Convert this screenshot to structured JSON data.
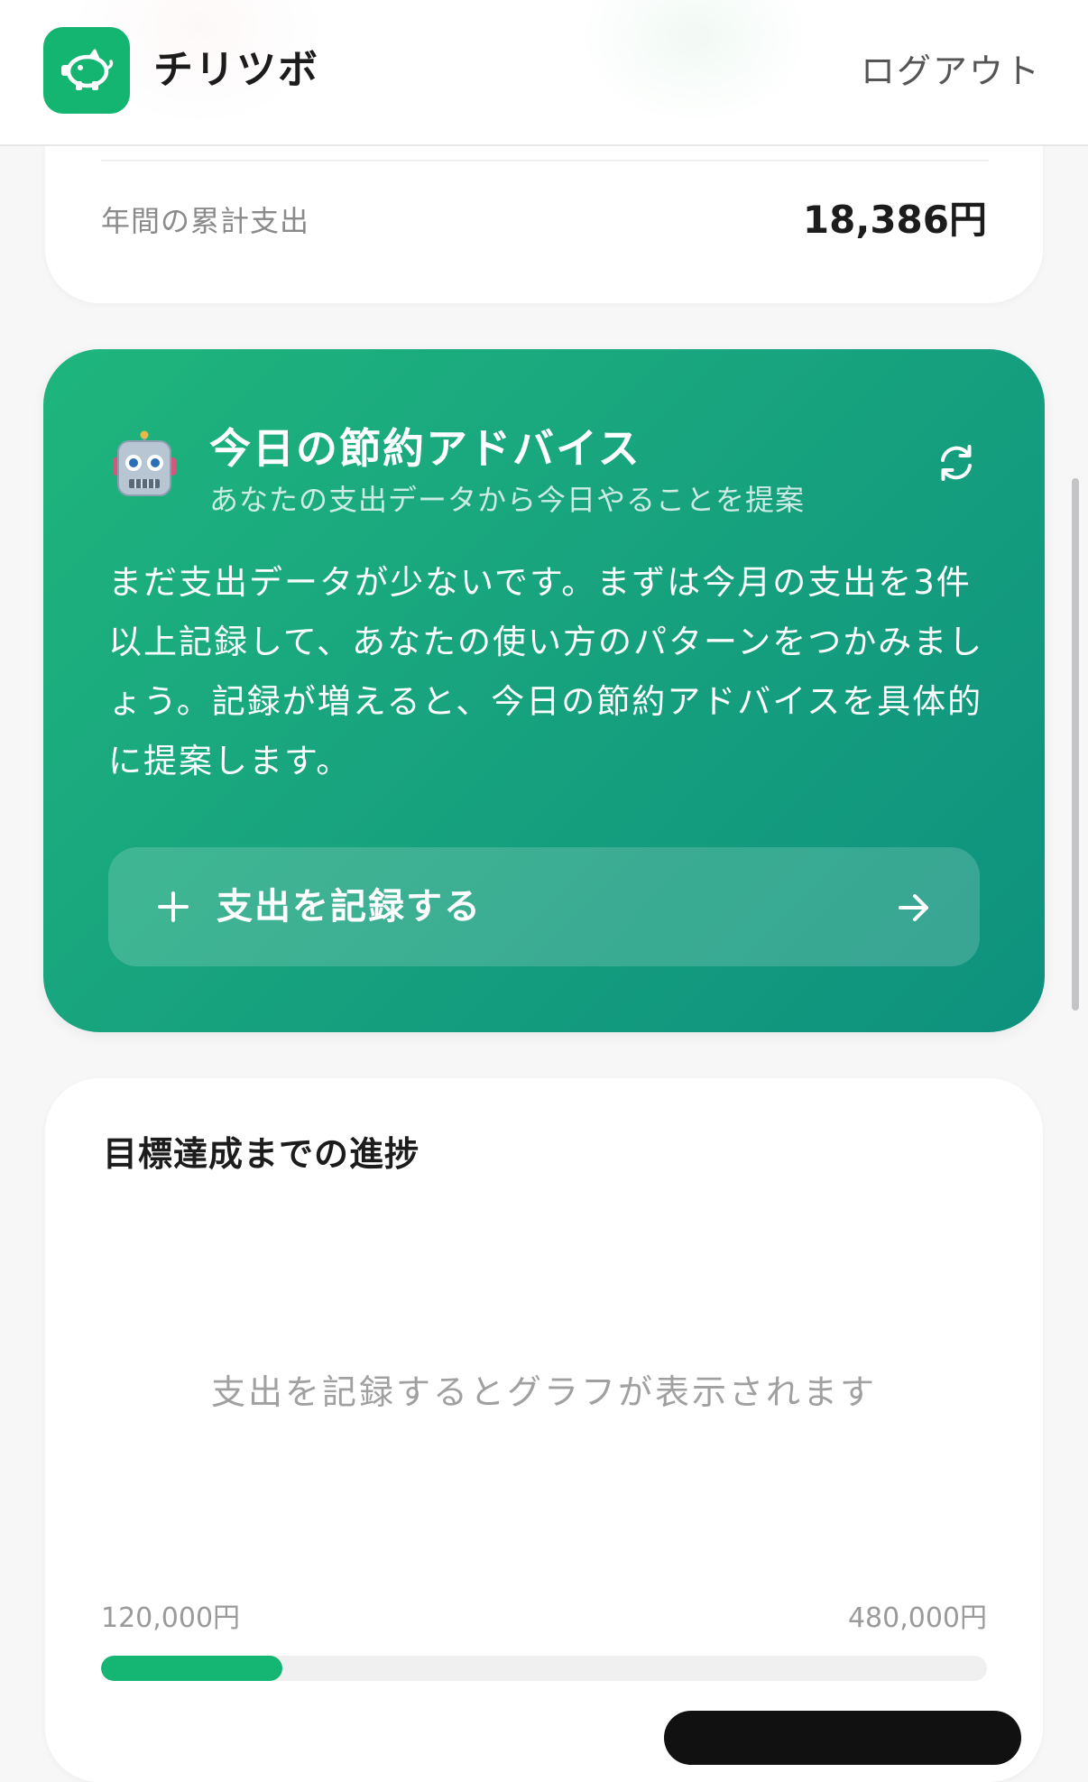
{
  "header": {
    "app_name": "チリツボ",
    "logout_label": "ログアウト",
    "brand_color": "#14b571"
  },
  "summary": {
    "annual_label": "年間の累計支出",
    "annual_value": "18,386円"
  },
  "advice": {
    "icon": "robot-icon",
    "title": "今日の節約アドバイス",
    "subtitle": "あなたの支出データから今日やることを提案",
    "refresh_icon": "refresh-icon",
    "body": "まだ支出データが少ないです。まずは今月の支出を3件以上記録して、あなたの使い方のパターンをつかみましょう。記録が増えると、今日の節約アドバイスを具体的に提案します。",
    "record_button_label": "支出を記録する",
    "gradient_start": "#1fb57d",
    "gradient_end": "#0e917e"
  },
  "progress": {
    "title": "目標達成までの進捗",
    "empty_message": "支出を記録するとグラフが表示されます",
    "min_label": "120,000円",
    "max_label": "480,000円",
    "fill_fraction": 0.205,
    "fill_color": "#15b674"
  }
}
